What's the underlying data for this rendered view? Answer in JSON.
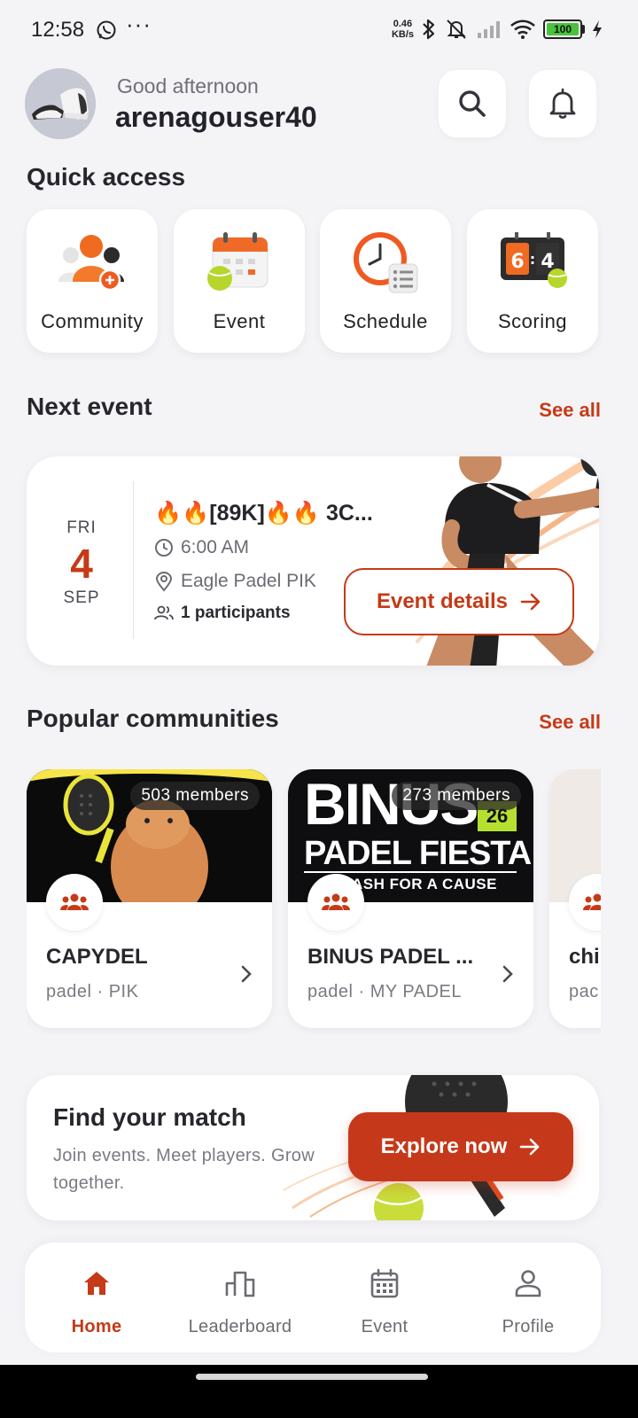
{
  "status_bar": {
    "time": "12:58",
    "network_speed_value": "0.46",
    "network_speed_unit": "KB/s",
    "battery": "100",
    "icons": [
      "whatsapp-icon",
      "more-dots-icon",
      "bluetooth-icon",
      "silent-icon",
      "signal-icon",
      "wifi-icon",
      "battery-icon",
      "charging-icon"
    ]
  },
  "header": {
    "greeting": "Good afternoon",
    "username": "arenagouser40"
  },
  "quick_access": {
    "title": "Quick access",
    "items": [
      {
        "label": "Community",
        "icon": "community-icon"
      },
      {
        "label": "Event",
        "icon": "calendar-icon"
      },
      {
        "label": "Schedule",
        "icon": "clock-schedule-icon"
      },
      {
        "label": "Scoring",
        "icon": "scoreboard-icon"
      }
    ]
  },
  "next_event": {
    "title": "Next event",
    "see_all": "See all",
    "event": {
      "day_of_week": "FRI",
      "day": "4",
      "month": "SEP",
      "name": "🔥🔥[89K]🔥🔥 3C...",
      "time": "6:00 AM",
      "location": "Eagle Padel PIK",
      "participants": "1 participants",
      "details_button": "Event details"
    }
  },
  "popular_communities": {
    "title": "Popular communities",
    "see_all": "See all",
    "items": [
      {
        "name": "CAPYDEL",
        "meta": "padel · PIK",
        "members": "503 members"
      },
      {
        "name": "BINUS PADEL ...",
        "meta": "padel · MY PADEL",
        "members": "273 members",
        "cover_title_line1": "BINUS",
        "cover_title_line2": "PADEL FIESTA",
        "cover_subtitle": "ASH FOR A CAUSE",
        "cover_year": "26"
      },
      {
        "name": "chi",
        "meta": "pac",
        "members": ""
      }
    ]
  },
  "promo": {
    "title": "Find your match",
    "subtitle": "Join events. Meet players. Grow together.",
    "button": "Explore now"
  },
  "bottom_nav": {
    "items": [
      {
        "label": "Home",
        "icon": "home-icon",
        "active": true
      },
      {
        "label": "Leaderboard",
        "icon": "leaderboard-icon",
        "active": false
      },
      {
        "label": "Event",
        "icon": "calendar-icon",
        "active": false
      },
      {
        "label": "Profile",
        "icon": "profile-icon",
        "active": false
      }
    ]
  },
  "colors": {
    "accent": "#c53a17",
    "background": "#f4f3f6",
    "card": "#ffffff",
    "text": "#26262c",
    "muted": "#7a7a82"
  }
}
